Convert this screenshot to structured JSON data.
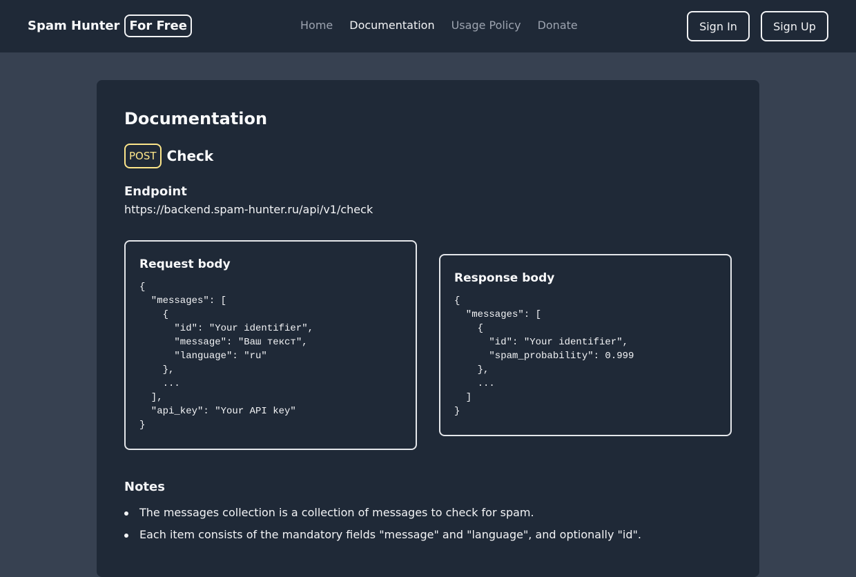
{
  "navbar": {
    "brand": "Spam Hunter",
    "brand_badge": "For Free",
    "links": [
      "Home",
      "Documentation",
      "Usage Policy",
      "Donate"
    ],
    "active_link": "Documentation",
    "sign_in": "Sign In",
    "sign_up": "Sign Up"
  },
  "page": {
    "title": "Documentation",
    "method": "POST",
    "method_name": "Check",
    "endpoint_label": "Endpoint",
    "endpoint_url": "https://backend.spam-hunter.ru/api/v1/check",
    "request": {
      "title": "Request body",
      "code": "{\n  \"messages\": [\n    {\n      \"id\": \"Your identifier\",\n      \"message\": \"Ваш текст\",\n      \"language\": \"ru\"\n    },\n    ...\n  ],\n  \"api_key\": \"Your API key\"\n}"
    },
    "response": {
      "title": "Response body",
      "code": "{\n  \"messages\": [\n    {\n      \"id\": \"Your identifier\",\n      \"spam_probability\": 0.999\n    },\n    ...\n  ]\n}"
    },
    "notes_title": "Notes",
    "notes": [
      "The messages collection is a collection of messages to check for spam.",
      "Each item consists of the mandatory fields \"message\" and \"language\", and optionally \"id\"."
    ]
  },
  "colors": {
    "navbar_bg": "#1f2937",
    "page_bg": "#374151",
    "card_bg": "#1f2937",
    "method_accent": "#fde68a"
  }
}
